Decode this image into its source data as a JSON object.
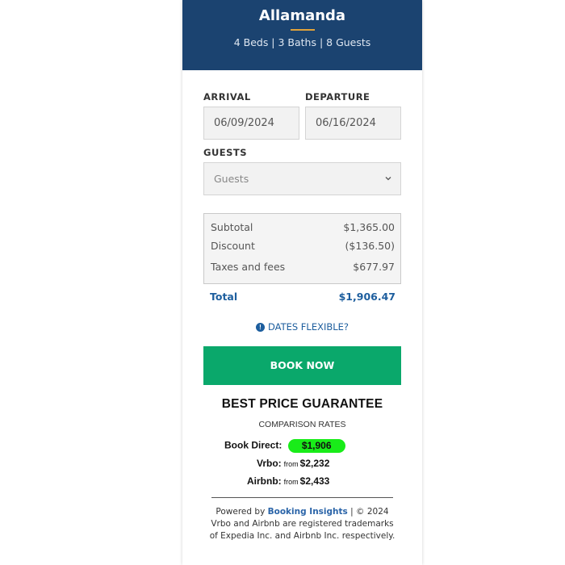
{
  "property": {
    "name": "Allamanda",
    "details": "4 Beds | 3 Baths | 8 Guests"
  },
  "booking": {
    "arrival_label": "ARRIVAL",
    "arrival_value": "06/09/2024",
    "departure_label": "DEPARTURE",
    "departure_value": "06/16/2024",
    "guests_label": "GUESTS",
    "guests_placeholder": "Guests"
  },
  "pricing": {
    "subtotal_label": "Subtotal",
    "subtotal_value": "$1,365.00",
    "discount_label": "Discount",
    "discount_value": "($136.50)",
    "taxes_label": "Taxes and fees",
    "taxes_value": "$677.97",
    "total_label": "Total",
    "total_value": "$1,906.47"
  },
  "flexible": {
    "icon": "info-icon",
    "label": "DATES FLEXIBLE?"
  },
  "book_button": "BOOK NOW",
  "guarantee": {
    "title": "BEST PRICE GUARANTEE",
    "subtitle": "COMPARISON RATES",
    "direct_label": "Book Direct:",
    "direct_value": "$1,906",
    "vrbo_label": "Vrbo:",
    "vrbo_from": "from",
    "vrbo_value": "$2,232",
    "airbnb_label": "Airbnb:",
    "airbnb_from": "from",
    "airbnb_value": "$2,433"
  },
  "footer": {
    "powered_prefix": "Powered by",
    "brand": "Booking Insights",
    "copyright": "| © 2024",
    "line2": "Vrbo and Airbnb are registered trademarks",
    "line3": "of Expedia Inc. and Airbnb Inc. respectively."
  },
  "colors": {
    "header_bg": "#1b4370",
    "accent_rule": "#e0a23b",
    "book_button": "#0aa86b",
    "link_blue": "#1d5e9e",
    "direct_pill": "#19ec19"
  }
}
